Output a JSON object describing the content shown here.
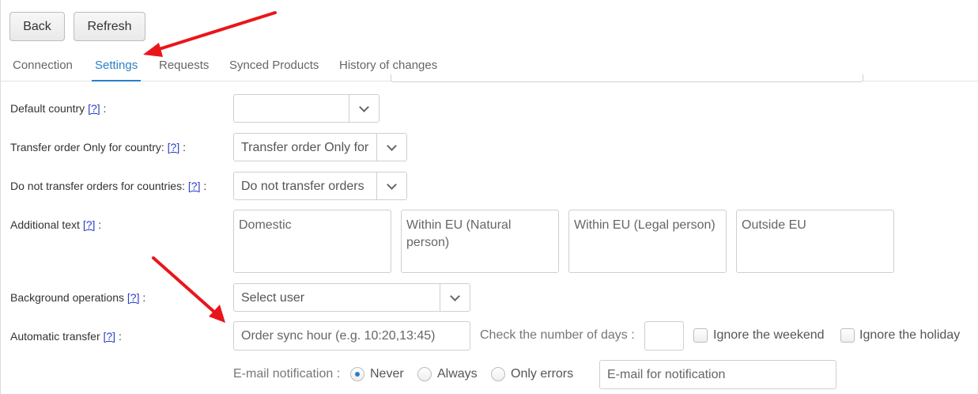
{
  "toolbar": {
    "back_label": "Back",
    "refresh_label": "Refresh"
  },
  "tabs": [
    {
      "label": "Connection",
      "active": false
    },
    {
      "label": "Settings",
      "active": true
    },
    {
      "label": "Requests",
      "active": false
    },
    {
      "label": "Synced Products",
      "active": false
    },
    {
      "label": "History of changes",
      "active": false
    }
  ],
  "help_marker": "[?]",
  "form": {
    "default_country": {
      "label": "Default country",
      "value": ""
    },
    "transfer_only_country": {
      "label": "Transfer order Only for country:",
      "value": "Transfer order Only for"
    },
    "no_transfer_countries": {
      "label": "Do not transfer orders for countries:",
      "value": "Do not transfer orders"
    },
    "additional_text": {
      "label": "Additional text",
      "fields": [
        "Domestic",
        "Within EU (Natural person)",
        "Within EU (Legal person)",
        "Outside EU"
      ]
    },
    "background_operations": {
      "label": "Background operations",
      "value": "Select user"
    },
    "automatic_transfer": {
      "label": "Automatic transfer",
      "sync_hour_placeholder": "Order sync hour (e.g. 10:20,13:45)",
      "days_label": "Check the number of days :",
      "days_value": "",
      "ignore_weekend_label": "Ignore the weekend",
      "ignore_weekend_checked": false,
      "ignore_holiday_label": "Ignore the holiday",
      "ignore_holiday_checked": false
    },
    "email_notification": {
      "label": "E-mail notification :",
      "options": [
        "Never",
        "Always",
        "Only errors"
      ],
      "selected": "Never",
      "email_placeholder": "E-mail for notification"
    }
  },
  "colors": {
    "accent": "#2a7fc9",
    "help_link": "#2a3fc9",
    "annotation_arrow": "#e8161b"
  }
}
